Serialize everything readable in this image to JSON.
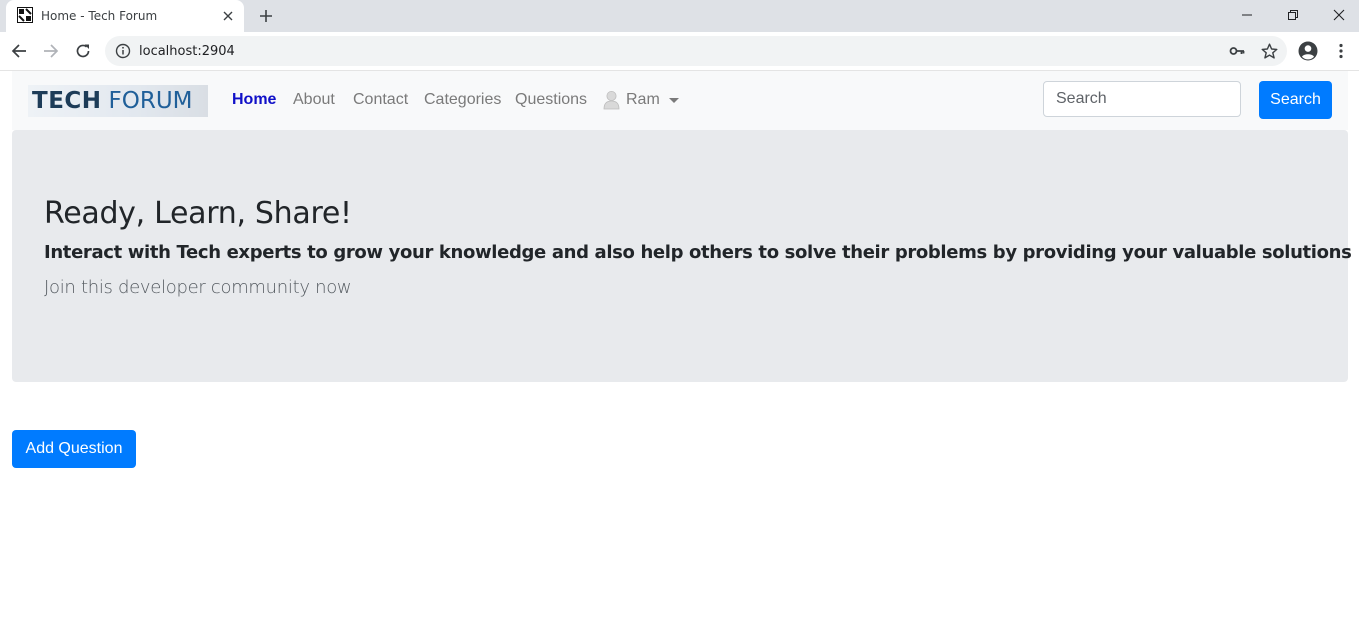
{
  "browser": {
    "tab_title": "Home - Tech Forum",
    "url": "localhost:2904",
    "icons": [
      "favicon-icon",
      "close-icon",
      "plus-icon",
      "minimize-icon",
      "restore-icon",
      "window-close-icon",
      "back-icon",
      "forward-icon",
      "reload-icon",
      "info-icon",
      "key-icon",
      "star-icon",
      "profile-icon",
      "menu-dots-icon"
    ]
  },
  "navbar": {
    "logo_part1": "TECH",
    "logo_part2": "FORUM",
    "links": [
      {
        "label": "Home",
        "active": true
      },
      {
        "label": "About"
      },
      {
        "label": "Contact"
      },
      {
        "label": "Categories"
      },
      {
        "label": "Questions"
      }
    ],
    "user": {
      "name": "Ram",
      "icon": "user-avatar-icon"
    },
    "search": {
      "placeholder": "Search",
      "button_label": "Search"
    }
  },
  "jumbotron": {
    "title": "Ready, Learn, Share!",
    "subtitle": "Interact with Tech experts to grow your knowledge and also help others to solve their problems by providing your valuable solutions",
    "lead": "Join this developer community now"
  },
  "actions": {
    "add_question_label": "Add Question"
  },
  "colors": {
    "primary": "#007bff",
    "active_link": "#1010c8",
    "navbar_bg": "#f8f9fa",
    "jumbotron_bg": "#e8eaed"
  }
}
